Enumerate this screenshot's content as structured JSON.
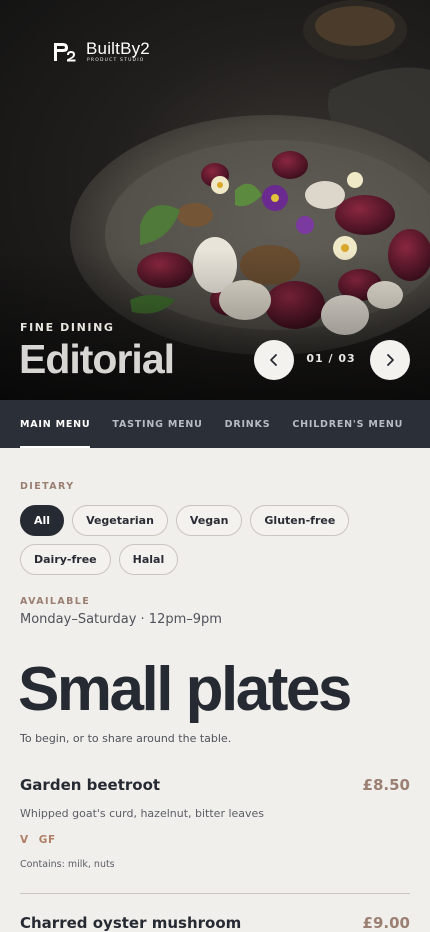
{
  "brand": {
    "name": "BuiltBy2",
    "tagline": "PRODUCT STUDIO"
  },
  "hero": {
    "eyebrow": "FINE DINING",
    "title": "Editorial",
    "counter": "01 / 03"
  },
  "tabs": [
    {
      "label": "MAIN MENU",
      "active": true
    },
    {
      "label": "TASTING MENU",
      "active": false
    },
    {
      "label": "DRINKS",
      "active": false
    },
    {
      "label": "CHILDREN'S MENU",
      "active": false
    }
  ],
  "dietary": {
    "label": "DIETARY",
    "options": [
      "All",
      "Vegetarian",
      "Vegan",
      "Gluten-free",
      "Dairy-free",
      "Halal"
    ],
    "selected": "All"
  },
  "availability": {
    "label": "AVAILABLE",
    "hours": "Monday–Saturday · 12pm–9pm"
  },
  "section": {
    "title": "Small plates",
    "intro": "To begin, or to share around the table."
  },
  "dishes": [
    {
      "name": "Garden beetroot",
      "price": "£8.50",
      "description": "Whipped goat's curd, hazelnut, bitter leaves",
      "tags": [
        "V",
        "GF"
      ],
      "contains": "Contains: milk, nuts"
    },
    {
      "name": "Charred oyster mushroom",
      "price": "£9.00"
    }
  ],
  "colors": {
    "accent": "#9a7f72",
    "dark": "#262a33",
    "tab_bar": "#2b2f38",
    "background": "#f1efeb",
    "tag": "#b07f68"
  },
  "icons": {
    "prev": "chevron-left-icon",
    "next": "chevron-right-icon",
    "logo": "builtby2-logo-mark"
  }
}
